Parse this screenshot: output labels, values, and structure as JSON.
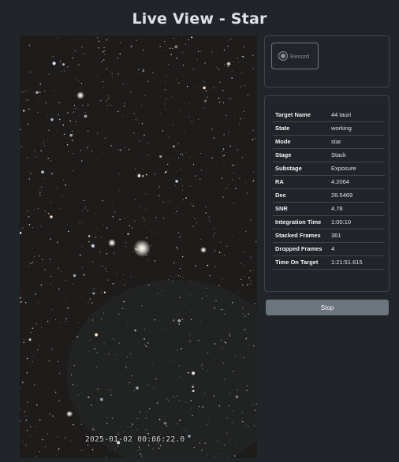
{
  "page": {
    "title": "Live View - Star"
  },
  "live_image": {
    "timestamp": "2025-01-02 00:06:22.0"
  },
  "record": {
    "label": "Record",
    "icon": "record-icon"
  },
  "info": {
    "rows": [
      {
        "key": "Target Name",
        "value": "44 tauri"
      },
      {
        "key": "State",
        "value": "working"
      },
      {
        "key": "Mode",
        "value": "star"
      },
      {
        "key": "Stage",
        "value": "Stack"
      },
      {
        "key": "Substage",
        "value": "Exposure"
      },
      {
        "key": "RA",
        "value": "4.2064"
      },
      {
        "key": "Dec",
        "value": "26.5469"
      },
      {
        "key": "SNR",
        "value": "4.78"
      },
      {
        "key": "Integration Time",
        "value": "1:00:10"
      },
      {
        "key": "Stacked Frames",
        "value": "361"
      },
      {
        "key": "Dropped Frames",
        "value": "4"
      },
      {
        "key": "Time On Target",
        "value": "1:21:51.615"
      }
    ]
  },
  "actions": {
    "stop_label": "Stop"
  },
  "colors": {
    "background": "#212529",
    "panel_border": "#3f454b",
    "button_gray": "#6c757d"
  }
}
